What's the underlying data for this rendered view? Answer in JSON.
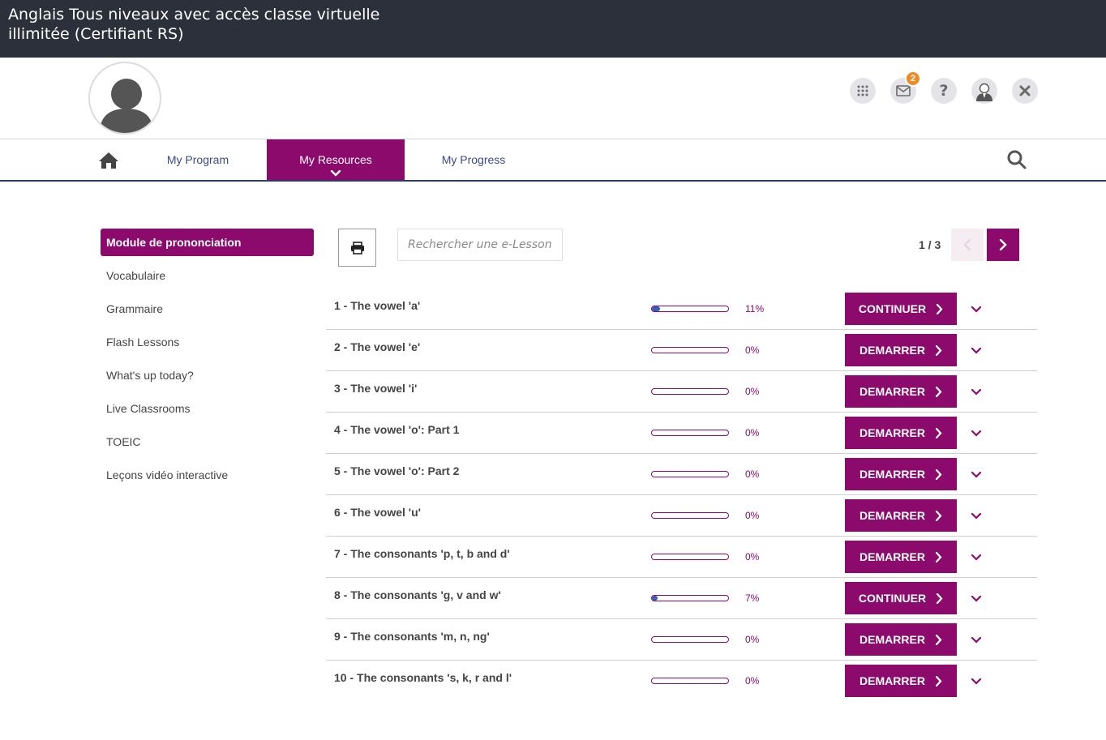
{
  "titlebar": {
    "title": "Anglais Tous niveaux avec accès classe virtuelle illimitée (Certifiant RS)"
  },
  "topbar": {
    "messages_badge": "2"
  },
  "nav": {
    "items": [
      {
        "label": "My Program"
      },
      {
        "label": "My Resources"
      },
      {
        "label": "My Progress"
      }
    ]
  },
  "sidebar": {
    "items": [
      {
        "label": "Module de prononciation"
      },
      {
        "label": "Vocabulaire"
      },
      {
        "label": "Grammaire"
      },
      {
        "label": "Flash Lessons"
      },
      {
        "label": "What's up today?"
      },
      {
        "label": "Live Classrooms"
      },
      {
        "label": "TOEIC"
      },
      {
        "label": "Leçons vidéo interactive"
      }
    ]
  },
  "toolbar": {
    "search_placeholder": "Rechercher une e-Lesson"
  },
  "pager": {
    "text": "1 / 3"
  },
  "lessons": [
    {
      "title": "1 - The vowel 'a'",
      "progress": 11,
      "progress_label": "11%",
      "action": "CONTINUER"
    },
    {
      "title": "2 - The vowel 'e'",
      "progress": 0,
      "progress_label": "0%",
      "action": "DEMARRER"
    },
    {
      "title": "3 - The vowel 'i'",
      "progress": 0,
      "progress_label": "0%",
      "action": "DEMARRER"
    },
    {
      "title": "4 - The vowel 'o': Part 1",
      "progress": 0,
      "progress_label": "0%",
      "action": "DEMARRER"
    },
    {
      "title": "5 - The vowel 'o': Part 2",
      "progress": 0,
      "progress_label": "0%",
      "action": "DEMARRER"
    },
    {
      "title": "6 - The vowel 'u'",
      "progress": 0,
      "progress_label": "0%",
      "action": "DEMARRER"
    },
    {
      "title": "7 - The consonants 'p, t, b and d'",
      "progress": 0,
      "progress_label": "0%",
      "action": "DEMARRER"
    },
    {
      "title": "8 - The consonants 'g, v and w'",
      "progress": 7,
      "progress_label": "7%",
      "action": "CONTINUER"
    },
    {
      "title": "9 - The consonants 'm, n, ng'",
      "progress": 0,
      "progress_label": "0%",
      "action": "DEMARRER"
    },
    {
      "title": "10 - The consonants 's, k, r and l'",
      "progress": 0,
      "progress_label": "0%",
      "action": "DEMARRER"
    }
  ],
  "colors": {
    "brand": "#8b0a6c",
    "header_bg": "#2b303b",
    "progress_fill": "#3b5bbd",
    "nav_text": "#3b4a8a"
  },
  "icons": {
    "home": "home-icon",
    "search": "search-icon",
    "apps": "apps-grid-icon",
    "mail": "mail-icon",
    "help": "help-icon",
    "user": "user-icon",
    "close": "close-icon",
    "print": "print-icon",
    "expand": "chevron-down-icon",
    "action": "chevron-right-icon"
  }
}
